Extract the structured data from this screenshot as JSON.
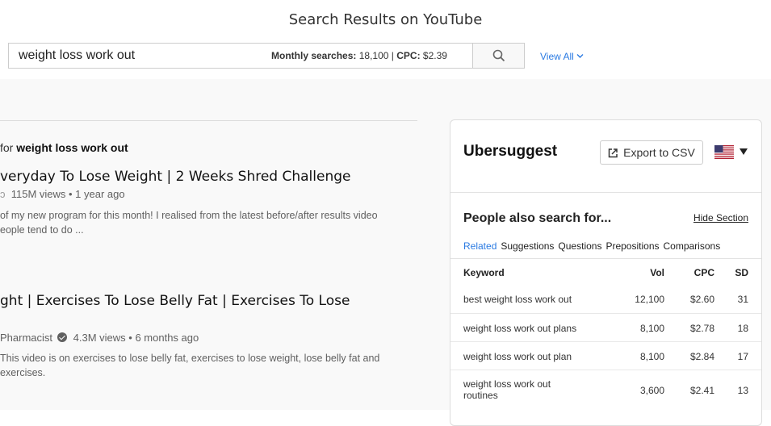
{
  "header": {
    "title": "Search Results on YouTube",
    "search_value": "weight loss work out",
    "monthly_label": "Monthly searches:",
    "monthly_value": "18,100",
    "sep": "|",
    "cpc_label": "CPC:",
    "cpc_value": "$2.39",
    "view_all": "View All"
  },
  "results": {
    "for_prefix": "for",
    "for_query": "weight loss work out",
    "items": [
      {
        "title": "veryday To Lose Weight | 2 Weeks Shred Challenge",
        "meta": "115M views • 1 year ago",
        "desc1": "of my new program for this month! I realised from the latest before/after results video",
        "desc2": "eople tend to do ..."
      },
      {
        "title": "ght | Exercises To Lose Belly Fat | Exercises To Lose",
        "channel": "Pharmacist",
        "meta": "4.3M views • 6 months ago",
        "desc1": "This video is on exercises to lose belly fat, exercises to lose weight, lose belly fat and",
        "desc2": "exercises."
      }
    ]
  },
  "uber": {
    "brand": "Ubersuggest",
    "export_label": "Export to CSV",
    "section_title": "People also search for...",
    "hide_label": "Hide Section",
    "tabs": [
      "Related",
      "Suggestions",
      "Questions",
      "Prepositions",
      "Comparisons"
    ],
    "columns": [
      "Keyword",
      "Vol",
      "CPC",
      "SD"
    ],
    "rows": [
      {
        "keyword": "best weight loss work out",
        "vol": "12,100",
        "cpc": "$2.60",
        "sd": "31"
      },
      {
        "keyword": "weight loss work out plans",
        "vol": "8,100",
        "cpc": "$2.78",
        "sd": "18"
      },
      {
        "keyword": "weight loss work out plan",
        "vol": "8,100",
        "cpc": "$2.84",
        "sd": "17"
      },
      {
        "keyword": "weight loss work out routines",
        "vol": "3,600",
        "cpc": "$2.41",
        "sd": "13"
      }
    ]
  },
  "colors": {
    "accent": "#2a7ae2",
    "flag_red": "#b22234",
    "flag_blue": "#3c3b6e"
  },
  "icons": [
    "search-icon",
    "chevron-down-icon",
    "export-icon",
    "us-flag-icon",
    "caret-down-icon",
    "verified-icon"
  ]
}
